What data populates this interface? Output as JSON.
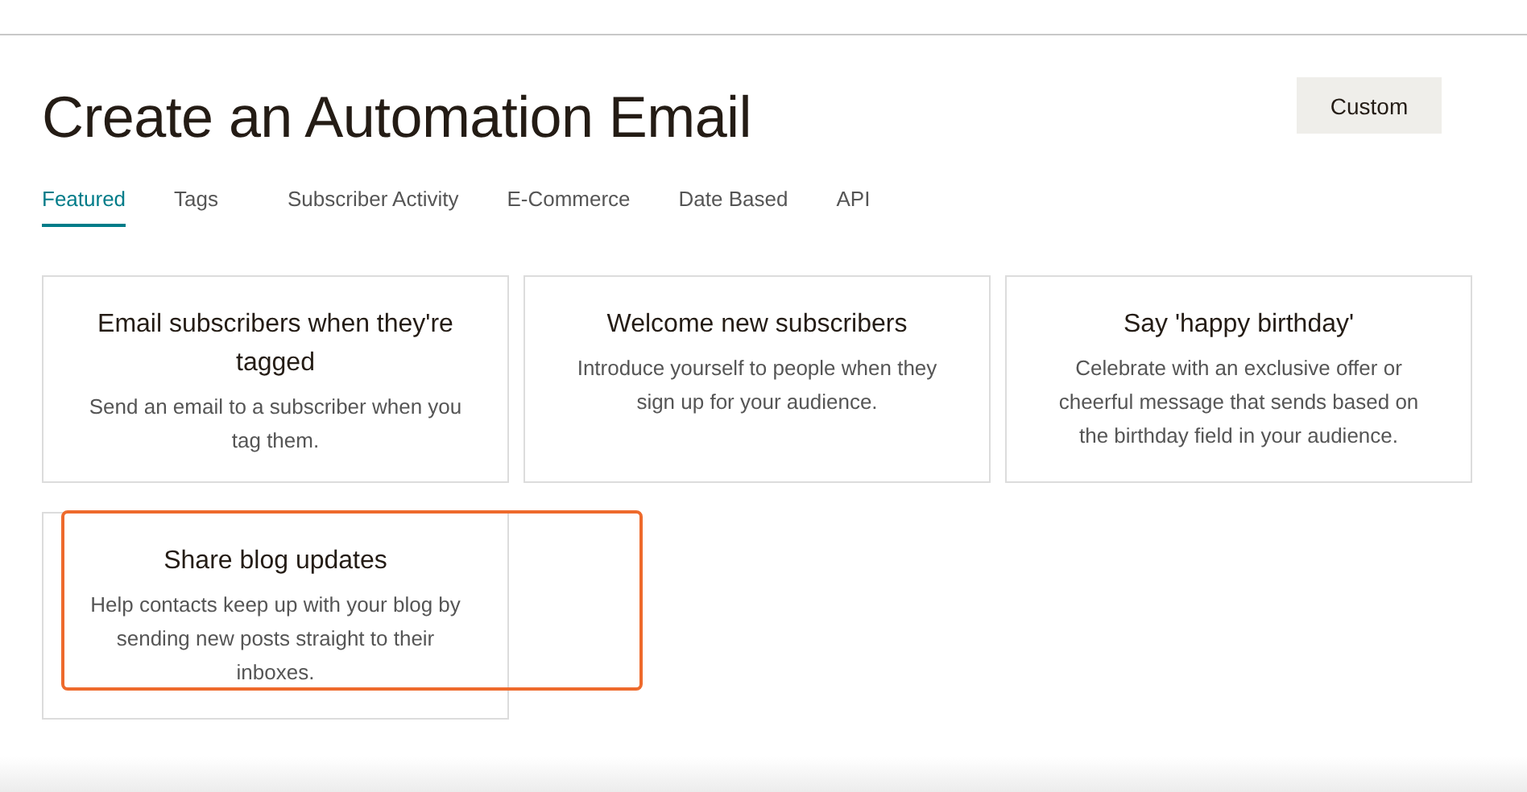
{
  "title": "Create an Automation Email",
  "custom_button": "Custom",
  "tabs": [
    {
      "label": "Featured",
      "selected": true
    },
    {
      "label": "Tags",
      "selected": false
    },
    {
      "label": "Subscriber Activity",
      "selected": false
    },
    {
      "label": "E-Commerce",
      "selected": false
    },
    {
      "label": "Date Based",
      "selected": false
    },
    {
      "label": "API",
      "selected": false
    }
  ],
  "cards": [
    {
      "title": "Email subscribers when they're tagged",
      "description": "Send an email to a subscriber when you tag them.",
      "highlighted": false
    },
    {
      "title": "Welcome new subscribers",
      "description": "Introduce yourself to people when they sign up for your audience.",
      "highlighted": false
    },
    {
      "title": "Say 'happy birthday'",
      "description": "Celebrate with an exclusive offer or cheerful message that sends based on the birthday field in your audience.",
      "highlighted": false
    },
    {
      "title": "Share blog updates",
      "description": "Help contacts keep up with your blog by sending new posts straight to their inboxes.",
      "highlighted": true
    }
  ]
}
